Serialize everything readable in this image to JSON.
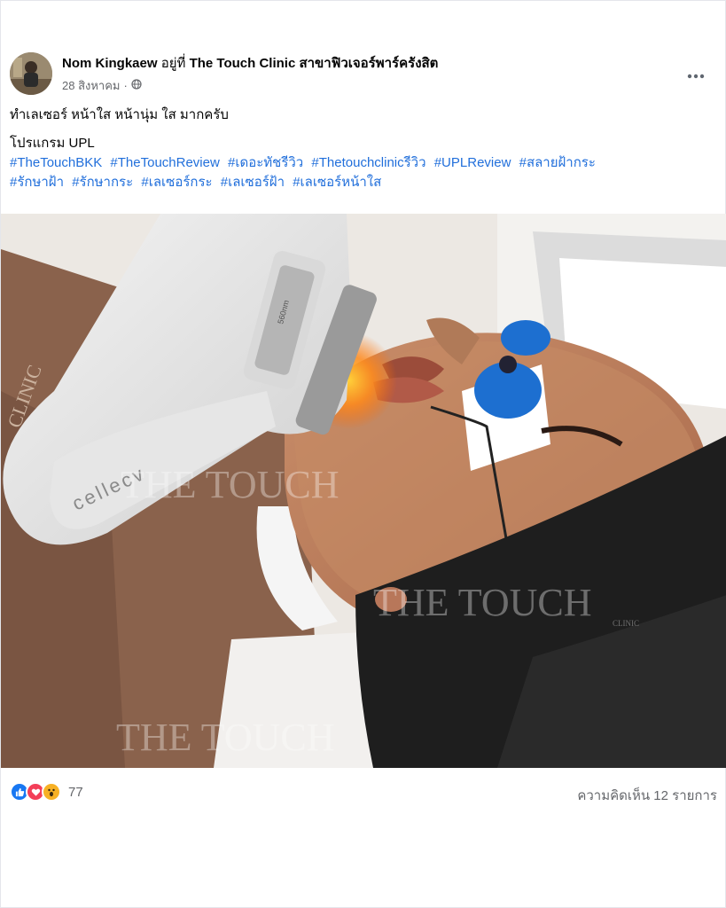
{
  "post": {
    "author": "Nom Kingkaew",
    "at_text": "อยู่ที่",
    "place": "The Touch Clinic สาขาฟิวเจอร์พาร์ครังสิต",
    "date": "28 สิงหาคม",
    "separator": "·",
    "privacy_icon": "globe-icon",
    "more_icon": "more-horizontal-icon",
    "text_line1": "ทำเลเซอร์ หน้าใส หน้านุ่ม ใส มากครับ",
    "text_line2": "โปรแกรม UPL",
    "hashtags": [
      "#TheTouchBKK",
      "#TheTouchReview",
      "#เดอะทัชรีวิว",
      "#Thetouchclinicรีวิว",
      "#UPLReview",
      "#สลายฝ้ากระ",
      "#รักษาฝ้า",
      "#รักษากระ",
      "#เลเซอร์กระ",
      "#เลเซอร์ฝ้า",
      "#เลเซอร์หน้าใส"
    ],
    "photo": {
      "device_brand": "cellecv",
      "wavelength": "560nm",
      "side_text": "CLINIC",
      "watermark": "THE TOUCH",
      "watermark_sub": "CLINIC"
    },
    "reactions": {
      "icons": [
        "like-icon",
        "love-icon",
        "wow-icon"
      ],
      "count": "77"
    },
    "comments": "ความคิดเห็น 12 รายการ"
  },
  "colors": {
    "link": "#216fdb",
    "secondary_text": "#65676b",
    "like": "#1877f2",
    "love": "#f33e58",
    "wow": "#f7b125"
  }
}
